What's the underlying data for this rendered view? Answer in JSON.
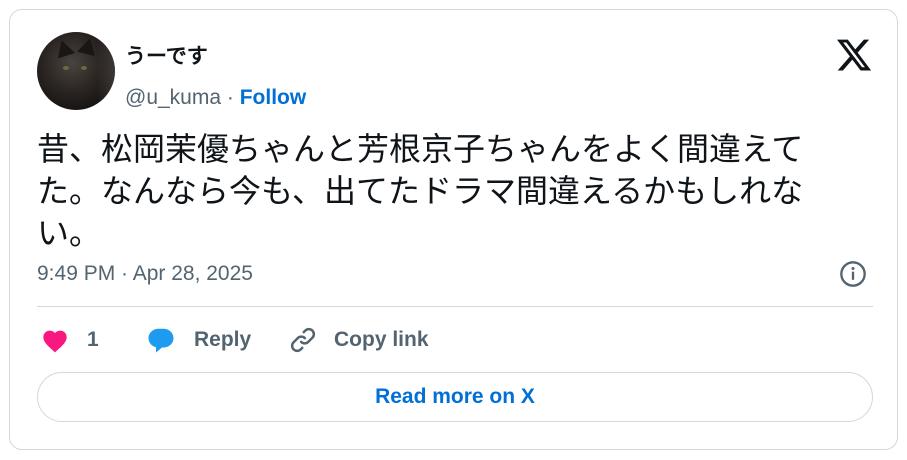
{
  "author": {
    "display_name": "うーです",
    "handle": "@u_kuma",
    "separator": " · ",
    "follow_label": "Follow"
  },
  "tweet": {
    "text": "昔、松岡茉優ちゃんと芳根京子ちゃんをよく間違えてた。なんなら今も、出てたドラマ間違えるかもしれない。",
    "timestamp": "9:49 PM · Apr 28, 2025"
  },
  "actions": {
    "like_count": "1",
    "reply_label": "Reply",
    "copy_label": "Copy link"
  },
  "footer": {
    "read_more_label": "Read more on X"
  },
  "icons": {
    "logo": "x-logo-icon",
    "info": "info-icon",
    "like": "heart-icon",
    "reply": "speech-bubble-icon",
    "copy": "link-icon"
  },
  "colors": {
    "link_blue": "#006fd6",
    "heart_pink": "#f91880",
    "reply_blue": "#1d9bf0",
    "muted_text": "#536471",
    "border": "#cfd9de"
  }
}
